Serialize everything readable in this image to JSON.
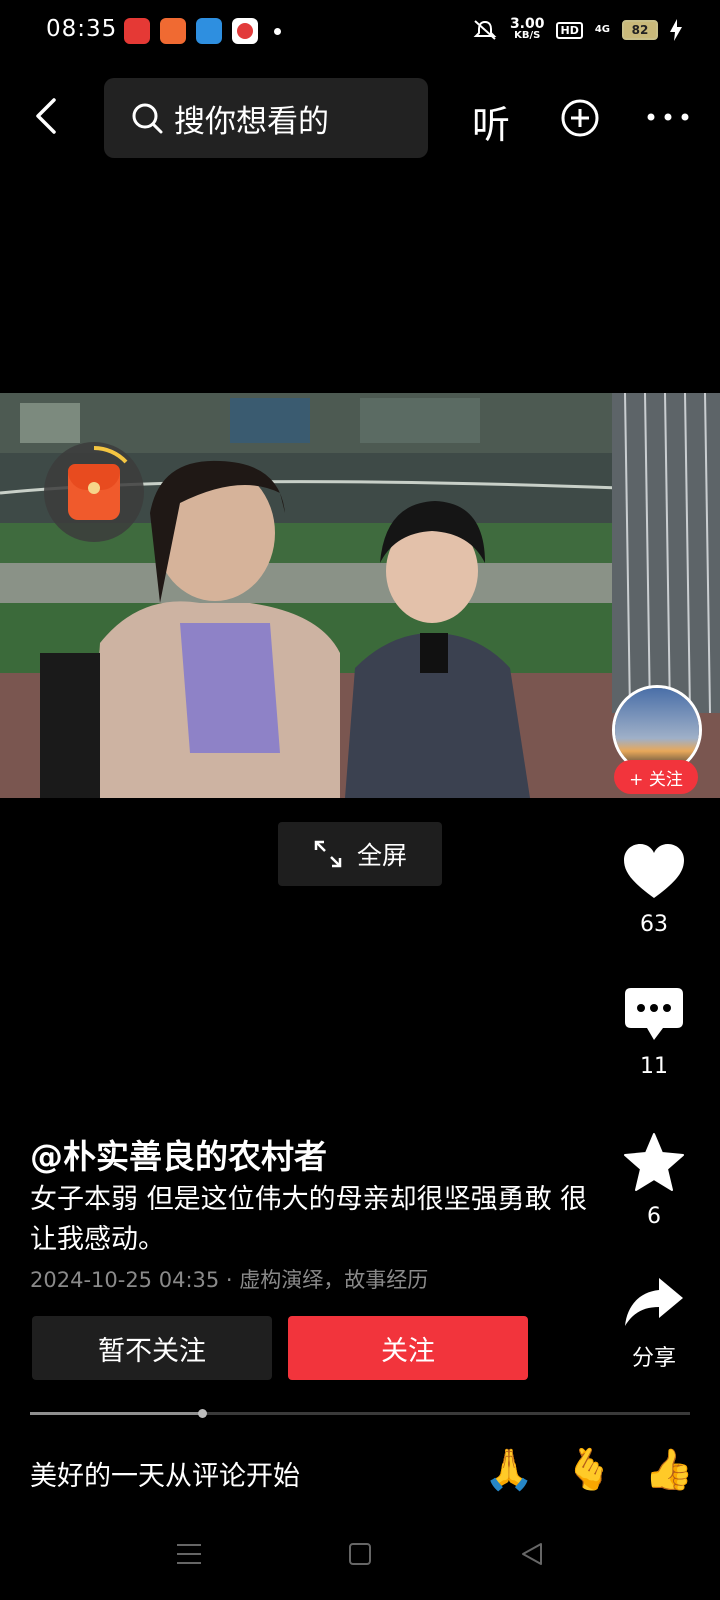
{
  "status_bar": {
    "time": "08:35",
    "speed_value": "3.00",
    "speed_unit": "KB/S",
    "hd": "HD",
    "network": "4G",
    "battery": "82"
  },
  "top_bar": {
    "search_placeholder": "搜你想看的",
    "listen_label": "听"
  },
  "video": {
    "author_follow_label": "+ 关注",
    "fullscreen_label": "全屏"
  },
  "actions": {
    "likes": "63",
    "comments": "11",
    "favorites": "6",
    "share_label": "分享"
  },
  "post": {
    "username": "@朴实善良的农村者",
    "description": "女子本弱 但是这位伟大的母亲却很坚强勇敢 很让我感动。",
    "meta": "2024-10-25 04:35 · 虚构演绎，故事经历"
  },
  "buttons": {
    "unfollow": "暂不关注",
    "follow": "关注"
  },
  "progress": {
    "fraction": 0.26
  },
  "comment_bar": {
    "placeholder": "美好的一天从评论开始",
    "emojis": [
      "🙏",
      "🫰",
      "👍"
    ]
  },
  "colors": {
    "accent_red": "#f2343c",
    "background": "#000000"
  }
}
